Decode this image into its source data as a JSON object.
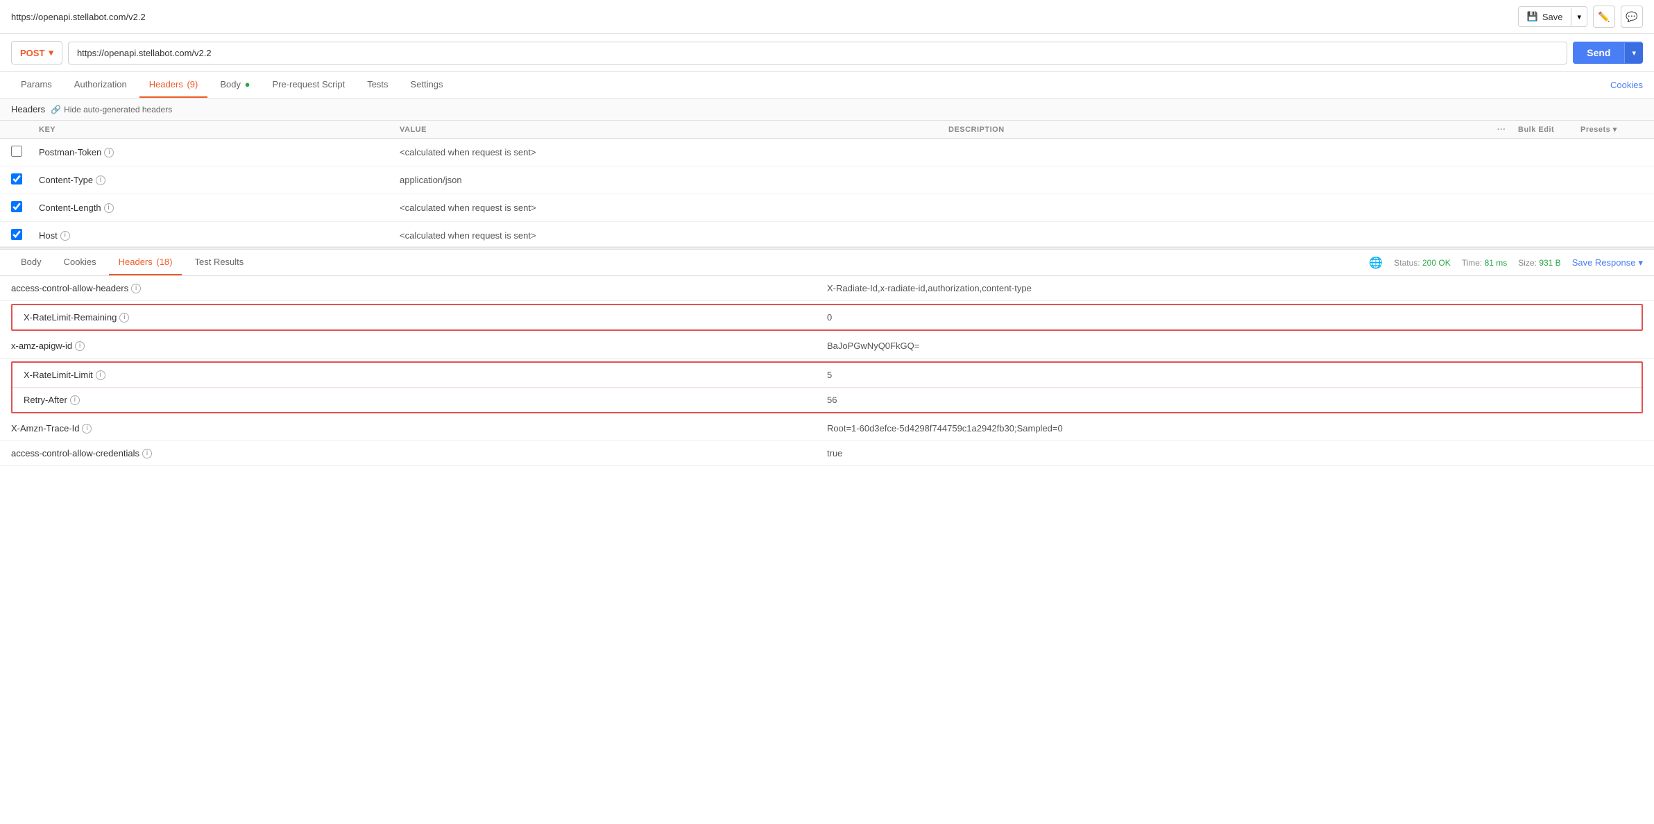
{
  "topbar": {
    "url": "https://openapi.stellabot.com/v2.2",
    "save_label": "Save",
    "save_dropdown_icon": "▾",
    "edit_icon": "✏",
    "comment_icon": "💬"
  },
  "urlbar": {
    "method": "POST",
    "method_dropdown": "▾",
    "url": "https://openapi.stellabot.com/v2.2",
    "send_label": "Send",
    "send_dropdown": "▾"
  },
  "request_tabs": [
    {
      "id": "params",
      "label": "Params",
      "active": false
    },
    {
      "id": "authorization",
      "label": "Authorization",
      "active": false
    },
    {
      "id": "headers",
      "label": "Headers",
      "badge": "(9)",
      "active": true
    },
    {
      "id": "body",
      "label": "Body",
      "dot": true,
      "active": false
    },
    {
      "id": "pre-request",
      "label": "Pre-request Script",
      "active": false
    },
    {
      "id": "tests",
      "label": "Tests",
      "active": false
    },
    {
      "id": "settings",
      "label": "Settings",
      "active": false
    }
  ],
  "cookies_label": "Cookies",
  "section_header": {
    "title": "Headers",
    "hide_label": "Hide auto-generated headers"
  },
  "req_table_headers": {
    "key": "KEY",
    "value": "VALUE",
    "description": "DESCRIPTION",
    "bulk_edit": "Bulk Edit",
    "presets": "Presets"
  },
  "request_headers": [
    {
      "checked": false,
      "key": "Postman-Token",
      "value": "<calculated when request is sent>",
      "description": ""
    },
    {
      "checked": true,
      "key": "Content-Type",
      "value": "application/json",
      "description": ""
    },
    {
      "checked": true,
      "key": "Content-Length",
      "value": "<calculated when request is sent>",
      "description": ""
    },
    {
      "checked": true,
      "key": "Host",
      "value": "<calculated when request is sent>",
      "description": ""
    }
  ],
  "response_tabs": [
    {
      "id": "body",
      "label": "Body",
      "active": false
    },
    {
      "id": "cookies",
      "label": "Cookies",
      "active": false
    },
    {
      "id": "headers",
      "label": "Headers",
      "badge": "(18)",
      "active": true
    },
    {
      "id": "test-results",
      "label": "Test Results",
      "active": false
    }
  ],
  "response_meta": {
    "status_label": "Status:",
    "status_value": "200 OK",
    "time_label": "Time:",
    "time_value": "81 ms",
    "size_label": "Size:",
    "size_value": "931 B",
    "save_response": "Save Response"
  },
  "response_headers": [
    {
      "key": "access-control-allow-headers",
      "value": "X-Radiate-Id,x-radiate-id,authorization,content-type",
      "highlighted": false
    },
    {
      "key": "X-RateLimit-Remaining",
      "value": "0",
      "highlighted": true
    },
    {
      "key": "x-amz-apigw-id",
      "value": "BaJoPGwNyQ0FkGQ=",
      "highlighted": false
    },
    {
      "key": "X-RateLimit-Limit",
      "value": "5",
      "highlighted": true
    },
    {
      "key": "Retry-After",
      "value": "56",
      "highlighted": true
    },
    {
      "key": "X-Amzn-Trace-Id",
      "value": "Root=1-60d3efce-5d4298f744759c1a2942fb30;Sampled=0",
      "highlighted": false
    },
    {
      "key": "access-control-allow-credentials",
      "value": "true",
      "highlighted": false
    }
  ]
}
